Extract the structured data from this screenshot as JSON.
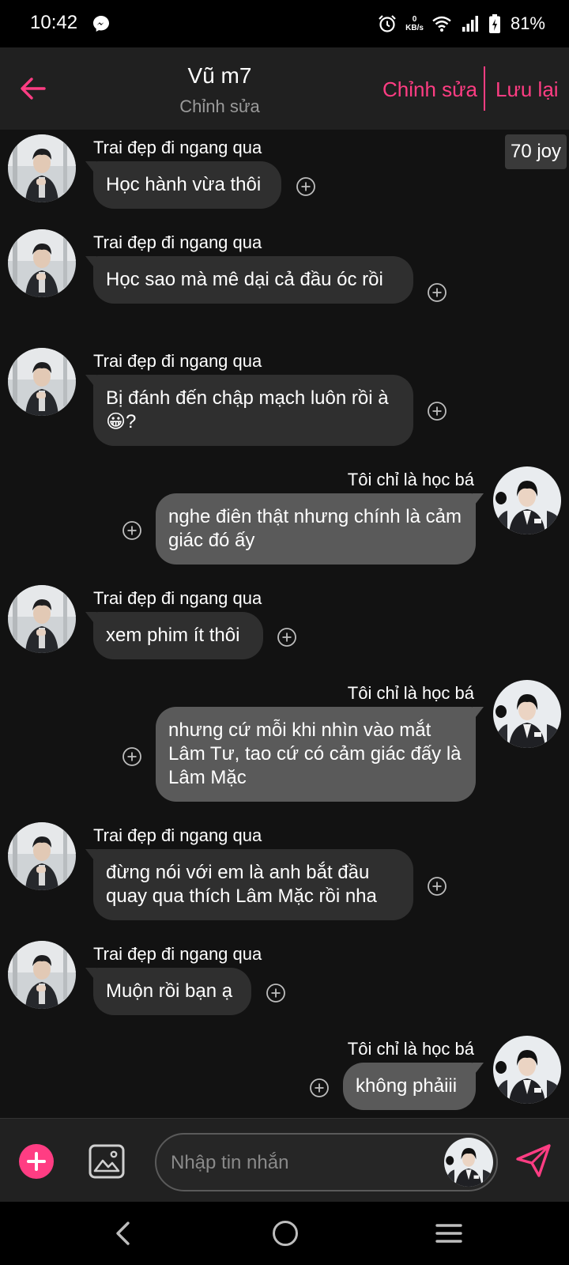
{
  "status_bar": {
    "time": "10:42",
    "net_speed_value": "0",
    "net_speed_unit": "KB/s",
    "battery": "81%"
  },
  "header": {
    "title": "Vũ m7",
    "subtitle": "Chỉnh sửa",
    "edit_label": "Chỉnh sửa",
    "save_label": "Lưu lại"
  },
  "chat": {
    "joy_badge": "70 joy",
    "messages": [
      {
        "sender": "Trai đẹp đi ngang qua",
        "text": "Học hành vừa thôi"
      },
      {
        "sender": "Trai đẹp đi ngang qua",
        "text": "Học sao mà mê dại cả đầu óc rồi"
      },
      {
        "sender": "Trai đẹp đi ngang qua",
        "text": "Bị đánh đến chập mạch luôn rồi à 😀?"
      },
      {
        "sender": "Tôi chỉ là học bá",
        "text": "nghe điên thật nhưng chính là cảm giác đó ấy"
      },
      {
        "sender": "Trai đẹp đi ngang qua",
        "text": "xem phim ít thôi"
      },
      {
        "sender": "Tôi chỉ là học bá",
        "text": "nhưng cứ mỗi khi nhìn vào mắt Lâm Tư, tao cứ có cảm giác đấy là Lâm Mặc"
      },
      {
        "sender": "Trai đẹp đi ngang qua",
        "text": "đừng nói với em là anh bắt đầu quay qua thích Lâm Mặc rồi nha"
      },
      {
        "sender": "Trai đẹp đi ngang qua",
        "text": "Muộn rồi bạn ạ"
      },
      {
        "sender": "Tôi chỉ là học bá",
        "text": "không phảiii"
      }
    ]
  },
  "composer": {
    "placeholder": "Nhập tin nhắn"
  },
  "colors": {
    "accent": "#ff3d83",
    "bubble_in": "#2f2f2f",
    "bubble_out": "#5a5a5a",
    "background": "#121212",
    "header": "#202020"
  },
  "icons": [
    "messenger-icon",
    "alarm-icon",
    "wifi-icon",
    "signal-icon",
    "battery-icon",
    "back-arrow-icon",
    "add-reaction-icon",
    "plus-icon",
    "image-icon",
    "send-icon",
    "nav-back-icon",
    "nav-home-icon",
    "nav-recents-icon"
  ]
}
